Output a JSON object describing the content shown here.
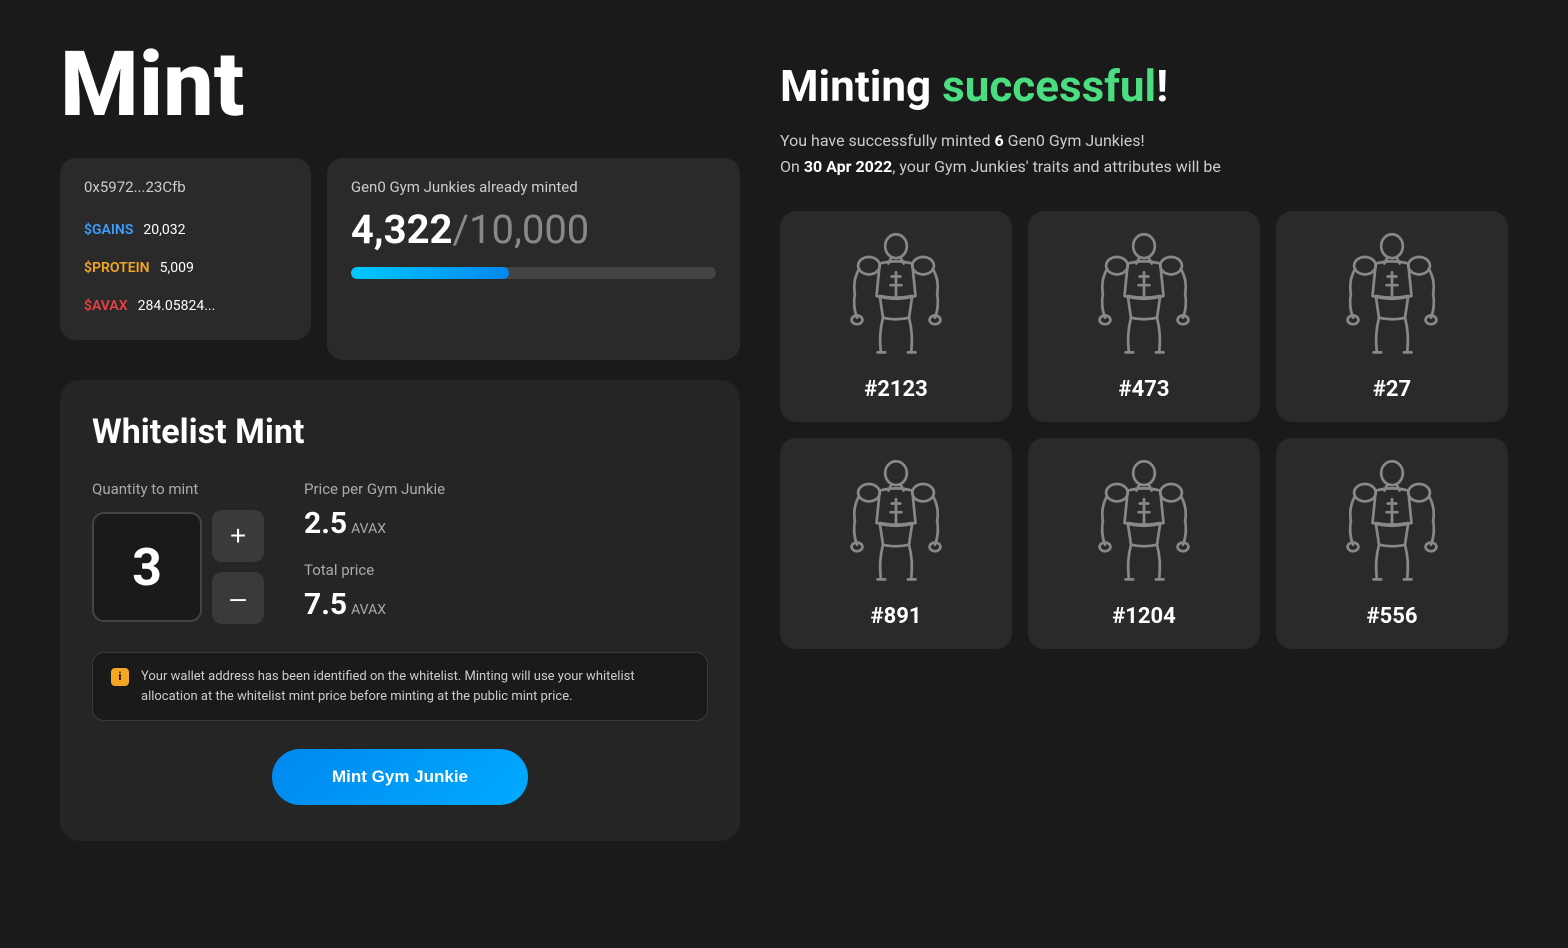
{
  "page": {
    "title": "Mint"
  },
  "wallet": {
    "address": "0x5972...23Cfb",
    "gains_label": "$GAINS",
    "gains_value": "20,032",
    "protein_label": "$PROTEIN",
    "protein_value": "5,009",
    "savax_label": "$AVAX",
    "savax_value": "284.05824..."
  },
  "minted_progress": {
    "label": "Gen0 Gym Junkies already minted",
    "current": "4,322",
    "total": "10,000",
    "separator": "/",
    "percent": 43.22
  },
  "whitelist_mint": {
    "title": "Whitelist Mint",
    "quantity_label": "Quantity to mint",
    "quantity": "3",
    "plus_btn": "+",
    "minus_btn": "–",
    "price_label": "Price per Gym Junkie",
    "price_value": "2.5",
    "price_unit": "AVAX",
    "total_label": "Total price",
    "total_value": "7.5",
    "total_unit": "AVAX",
    "notice": "Your wallet address has been identified on the whitelist. Minting will use your whitelist allocation at the whitelist mint price before minting at the public mint price.",
    "mint_button": "Mint Gym Junkie"
  },
  "success": {
    "title_prefix": "Minting ",
    "title_highlight": "successful",
    "title_suffix": "!",
    "description_line1_prefix": "You have successfully minted ",
    "description_quantity": "6",
    "description_line1_suffix": " Gen0 Gym Junkies!",
    "description_line2_prefix": "On ",
    "description_date": "30 Apr 2022",
    "description_line2_suffix": ", your Gym Junkies' traits and attributes will be"
  },
  "nfts": [
    {
      "id": "#2123"
    },
    {
      "id": "#473"
    },
    {
      "id": "#27"
    },
    {
      "id": "#891"
    },
    {
      "id": "#1204"
    },
    {
      "id": "#556"
    }
  ]
}
